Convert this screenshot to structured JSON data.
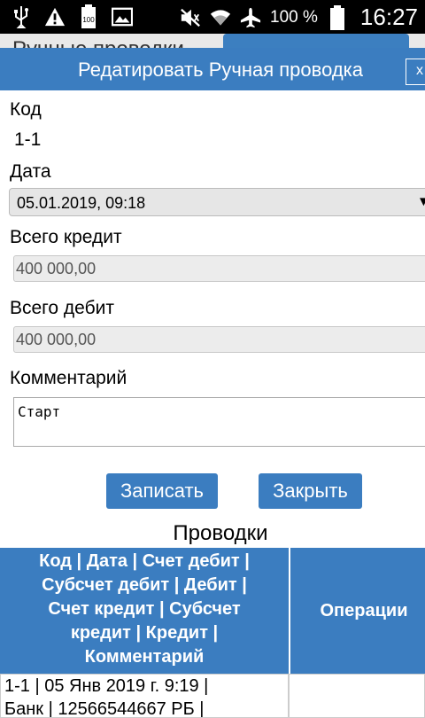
{
  "status_bar": {
    "icons": [
      "usb-icon",
      "warning-icon",
      "battery-full-icon",
      "image-icon",
      "mute-icon",
      "wifi-icon",
      "airplane-icon",
      "battery-icon"
    ],
    "battery_small_text": "100",
    "battery_percent": "100 %",
    "time": "16:27"
  },
  "background_page": {
    "title": "Ручные проводки"
  },
  "dialog": {
    "title": "Редатировать Ручная проводка",
    "close_label": "x",
    "code_label": "Код",
    "code_value": "1-1",
    "date_label": "Дата",
    "date_value": "05.01.2019, 09:18",
    "credit_label": "Всего кредит",
    "credit_value": "400 000,00",
    "debit_label": "Всего дебит",
    "debit_value": "400 000,00",
    "comment_label": "Комментарий",
    "comment_value": "Старт",
    "save_label": "Записать",
    "close_button_label": "Закрыть",
    "section_title": "Проводки"
  },
  "table": {
    "header_lines": [
      "Код | Дата | Счет дебит |",
      "Субсчет дебит | Дебит |",
      "Счет кредит | Субсчет",
      "кредит | Кредит |",
      "Комментарий"
    ],
    "operations_header": "Операции",
    "rows": [
      {
        "line1": "1-1 | 05 Янв 2019 г. 9:19 |",
        "line2": "Банк | 12566544667 РБ |"
      }
    ]
  },
  "colors": {
    "primary": "#3b7dc0",
    "status_bar": "#000000"
  }
}
